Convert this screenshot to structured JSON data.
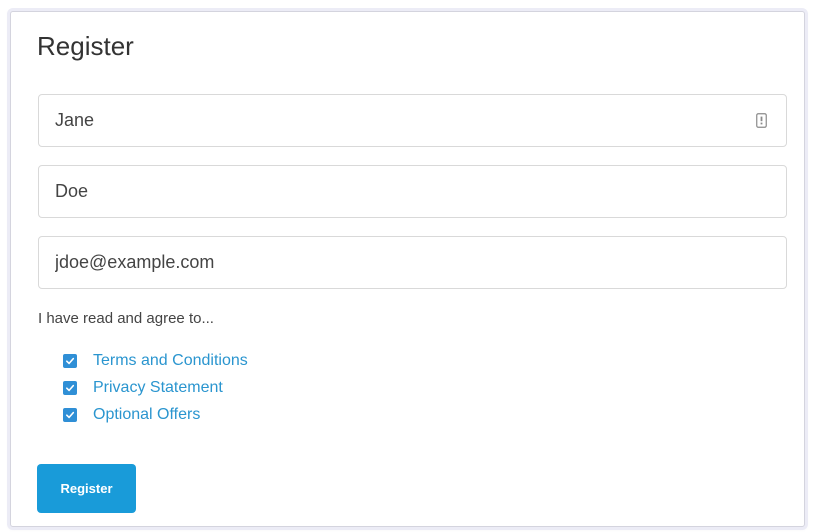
{
  "form": {
    "title": "Register",
    "fields": [
      {
        "value": "Jane",
        "placeholder": ""
      },
      {
        "value": "Doe",
        "placeholder": ""
      },
      {
        "value": "jdoe@example.com",
        "placeholder": ""
      }
    ],
    "agree_label": "I have read and agree to...",
    "agreements": [
      {
        "label": "Terms and Conditions",
        "checked": true
      },
      {
        "label": "Privacy Statement",
        "checked": true
      },
      {
        "label": "Optional Offers",
        "checked": true
      }
    ],
    "submit_label": "Register"
  },
  "icons": {
    "autofill": "autofill-icon",
    "checkbox": "checkmark-icon"
  },
  "colors": {
    "accent": "#199bd9",
    "link": "#2a95cf",
    "checkbox": "#2f8fd6",
    "text": "#444444",
    "border": "#d9d9d9"
  }
}
